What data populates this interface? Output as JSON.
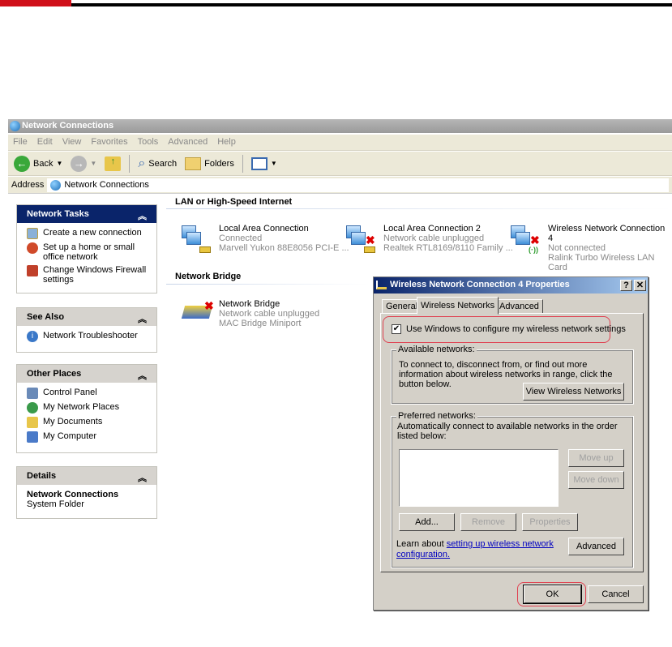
{
  "window": {
    "title": "Network Connections"
  },
  "menu": [
    "File",
    "Edit",
    "View",
    "Favorites",
    "Tools",
    "Advanced",
    "Help"
  ],
  "toolbar": {
    "back": "Back",
    "search": "Search",
    "folders": "Folders"
  },
  "address": {
    "label": "Address",
    "value": "Network Connections"
  },
  "panels": {
    "network_tasks": {
      "title": "Network Tasks",
      "items": [
        "Create a new connection",
        "Set up a home or small office network",
        "Change Windows Firewall settings"
      ]
    },
    "see_also": {
      "title": "See Also",
      "items": [
        "Network Troubleshooter"
      ]
    },
    "other_places": {
      "title": "Other Places",
      "items": [
        "Control Panel",
        "My Network Places",
        "My Documents",
        "My Computer"
      ]
    },
    "details": {
      "title": "Details",
      "name": "Network Connections",
      "type": "System Folder"
    }
  },
  "sections": {
    "lan": {
      "title": "LAN or High-Speed Internet",
      "items": [
        {
          "name": "Local Area Connection",
          "status": "Connected",
          "device": "Marvell Yukon 88E8056 PCI-E ..."
        },
        {
          "name": "Local Area Connection 2",
          "status": "Network cable unplugged",
          "device": "Realtek RTL8169/8110 Family ..."
        },
        {
          "name": "Wireless Network Connection 4",
          "status": "Not connected",
          "device": "Ralink Turbo Wireless LAN Card"
        }
      ]
    },
    "bridge": {
      "title": "Network Bridge",
      "items": [
        {
          "name": "Network Bridge",
          "status": "Network cable unplugged",
          "device": "MAC Bridge Miniport"
        }
      ]
    }
  },
  "dialog": {
    "title": "Wireless Network Connection 4 Properties",
    "help": "?",
    "close": "✕",
    "tabs": [
      "General",
      "Wireless Networks",
      "Advanced"
    ],
    "checkbox_label": "Use Windows to configure my wireless network settings",
    "available": {
      "label": "Available networks:",
      "text": "To connect to, disconnect from, or find out more information about wireless networks in range, click the button below.",
      "button": "View Wireless Networks"
    },
    "preferred": {
      "label": "Preferred networks:",
      "text": "Automatically connect to available networks in the order listed below:",
      "move_up": "Move up",
      "move_down": "Move down",
      "add": "Add...",
      "remove": "Remove",
      "properties": "Properties"
    },
    "learn_prefix": "Learn about ",
    "learn_link": "setting up wireless network configuration.",
    "advanced": "Advanced",
    "ok": "OK",
    "cancel": "Cancel"
  }
}
